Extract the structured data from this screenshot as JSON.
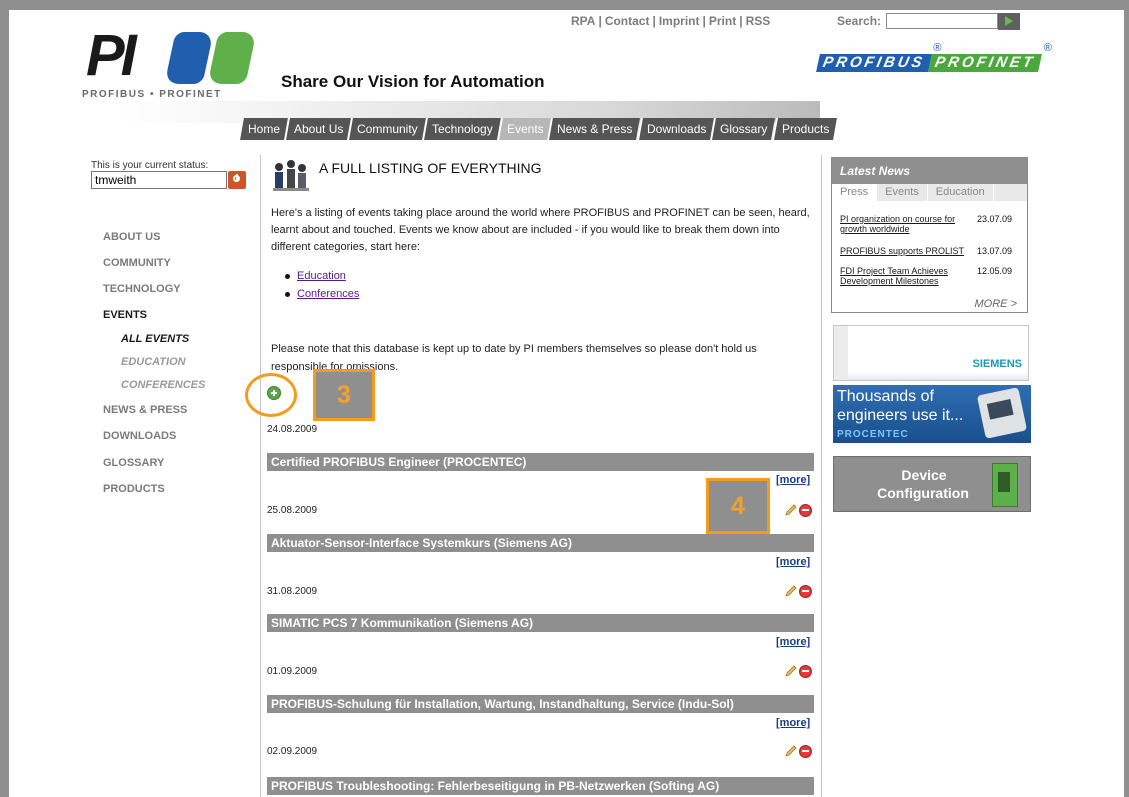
{
  "header": {
    "utility_links": [
      "RPA",
      "Contact",
      "Imprint",
      "Print",
      "RSS"
    ],
    "search_label": "Search:",
    "search_value": "",
    "logo_text": "PI",
    "logo_subtitle": "PROFIBUS • PROFINET",
    "tagline": "Share Our Vision for Automation",
    "brand_logos": [
      "PROFIBUS",
      "PROFINET"
    ]
  },
  "nav": {
    "tabs": [
      "Home",
      "About Us",
      "Community",
      "Technology",
      "Events",
      "News & Press",
      "Downloads",
      "Glossary",
      "Products"
    ],
    "active": "Events"
  },
  "sidebar": {
    "status_label": "This is your current status:",
    "status_value": "tmweith",
    "items": [
      {
        "label": "ABOUT US"
      },
      {
        "label": "COMMUNITY"
      },
      {
        "label": "TECHNOLOGY"
      },
      {
        "label": "EVENTS"
      },
      {
        "label": "ALL EVENTS"
      },
      {
        "label": "EDUCATION"
      },
      {
        "label": "CONFERENCES"
      },
      {
        "label": "NEWS & PRESS"
      },
      {
        "label": "DOWNLOADS"
      },
      {
        "label": "GLOSSARY"
      },
      {
        "label": "PRODUCTS"
      }
    ]
  },
  "main": {
    "title": "A FULL LISTING OF EVERYTHING",
    "intro": "Here's a listing of events taking place around the world where PROFIBUS and PROFINET can be seen, heard, learnt about and touched. Events we know about are included - if you would like to break them down into different categories, start here:",
    "links": [
      "Education",
      "Conferences"
    ],
    "note": "Please note that this database is kept up to date by PI members themselves so please don't hold us responsible for omissions.",
    "callouts": [
      "3",
      "4"
    ],
    "more_label": "[more]",
    "events": [
      {
        "date": "24.08.2009",
        "title": "Certified PROFIBUS Engineer (PROCENTEC)"
      },
      {
        "date": "25.08.2009",
        "title": "Aktuator-Sensor-Interface Systemkurs (Siemens AG)"
      },
      {
        "date": "31.08.2009",
        "title": "SIMATIC PCS 7 Kommunikation (Siemens AG)"
      },
      {
        "date": "01.09.2009",
        "title": "PROFIBUS-Schulung für Installation, Wartung, Instandhaltung, Service (Indu-Sol)"
      },
      {
        "date": "02.09.2009",
        "title": "PROFIBUS Troubleshooting: Fehlerbeseitigung in PB-Netzwerken (Softing AG)"
      }
    ]
  },
  "latest_news": {
    "title": "Latest News",
    "tabs": [
      "Press",
      "Events",
      "Education"
    ],
    "items": [
      {
        "text": "PI organization on course for growth worldwide",
        "date": "23.07.09"
      },
      {
        "text": "PROFIBUS supports PROLIST",
        "date": "13.07.09"
      },
      {
        "text": "FDI Project Team Achieves Development Milestones",
        "date": "12.05.09"
      }
    ],
    "more": "MORE >"
  },
  "ads": {
    "siemens": "SIEMENS",
    "procentec_line1": "Thousands of",
    "procentec_line2": "engineers use it...",
    "procentec_brand": "PROCENTEC",
    "devconf_line1": "Device",
    "devconf_line2": "Configuration"
  },
  "colors": {
    "bar_gray": "#8f8f8f",
    "nav_dark": "#555555",
    "callout_orange": "#f39c1e",
    "profi_blue": "#1f5fae"
  }
}
